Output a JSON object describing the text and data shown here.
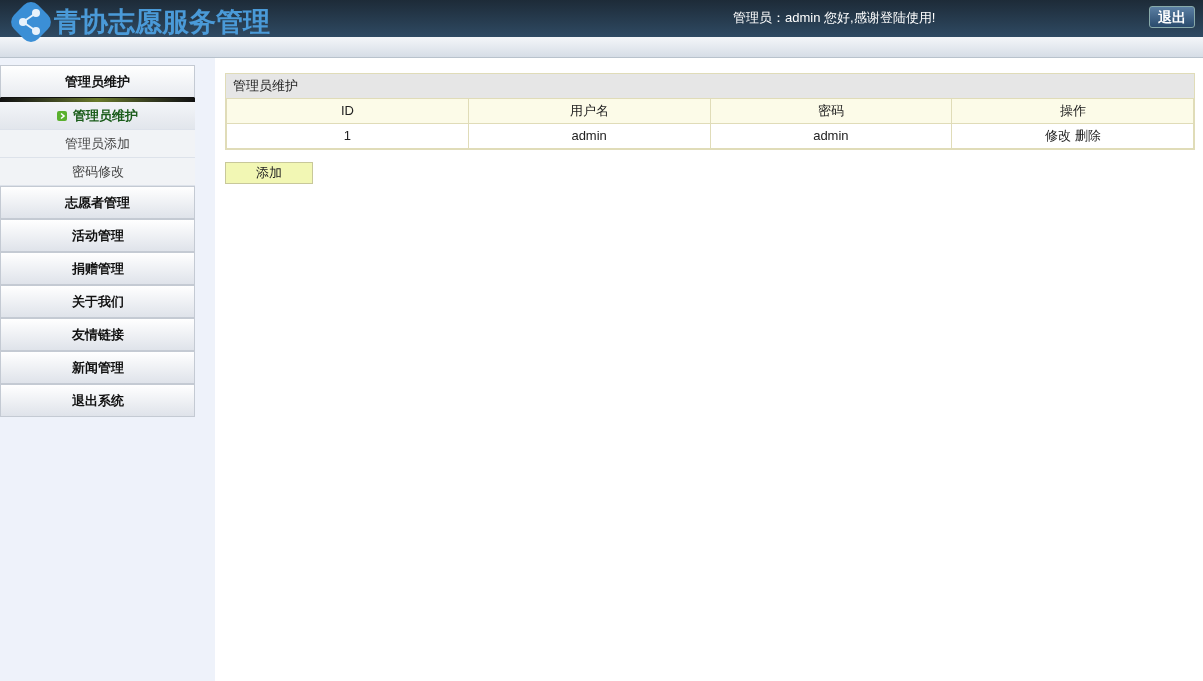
{
  "header": {
    "title": "青协志愿服务管理",
    "greeting": "管理员：admin 您好,感谢登陆使用!",
    "logout_button": "退出"
  },
  "sidebar": {
    "sections": [
      {
        "label": "管理员维护",
        "expanded": true,
        "items": [
          {
            "label": "管理员维护",
            "selected": true
          },
          {
            "label": "管理员添加",
            "selected": false
          },
          {
            "label": "密码修改",
            "selected": false
          }
        ]
      },
      {
        "label": "志愿者管理",
        "expanded": false
      },
      {
        "label": "活动管理",
        "expanded": false
      },
      {
        "label": "捐赠管理",
        "expanded": false
      },
      {
        "label": "关于我们",
        "expanded": false
      },
      {
        "label": "友情链接",
        "expanded": false
      },
      {
        "label": "新闻管理",
        "expanded": false
      },
      {
        "label": "退出系统",
        "expanded": false
      }
    ]
  },
  "table": {
    "title": "管理员维护",
    "columns": [
      "ID",
      "用户名",
      "密码",
      "操作"
    ],
    "rows": [
      {
        "id": "1",
        "username": "admin",
        "password": "admin",
        "actions": [
          "修改",
          "删除"
        ]
      }
    ]
  },
  "add_button": "添加"
}
